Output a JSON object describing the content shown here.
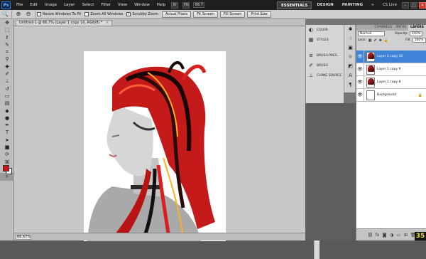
{
  "menubar": {
    "logo": "Ps",
    "items": [
      "File",
      "Edit",
      "Image",
      "Layer",
      "Select",
      "Filter",
      "View",
      "Window",
      "Help"
    ],
    "bridge_icon": "Br",
    "mini_bridge_icon": "Mb",
    "zoom_value": "66.7",
    "workspaces": [
      "ESSENTIALS",
      "DESIGN",
      "PAINTING",
      "»"
    ],
    "cs_live": "CS Live",
    "window_controls": [
      "–",
      "□",
      "×"
    ]
  },
  "options": {
    "checks": [
      {
        "label": "Resize Windows To Fit",
        "checked": false
      },
      {
        "label": "Zoom All Windows",
        "checked": false
      },
      {
        "label": "Scrubby Zoom",
        "checked": true
      }
    ],
    "buttons": [
      "Actual Pixels",
      "Fit Screen",
      "Fill Screen",
      "Print Size"
    ]
  },
  "document": {
    "tab_title": "Untitled-1 @ 66.7% (Layer 1 copy 10, RGB/8) *",
    "close": "×",
    "status_zoom": "66.67%"
  },
  "tools": [
    "move-icon",
    "marquee-icon",
    "lasso-icon",
    "quick-select-icon",
    "crop-icon",
    "eyedropper-icon",
    "healing-icon",
    "brush-icon",
    "clone-stamp-icon",
    "history-brush-icon",
    "eraser-icon",
    "gradient-icon",
    "blur-icon",
    "dodge-icon",
    "pen-icon",
    "type-icon",
    "path-select-icon",
    "shape-icon",
    "3d-rotate-icon",
    "3d-camera-icon",
    "hand-icon",
    "zoom-icon"
  ],
  "swatches": {
    "foreground": "#c8161a",
    "background": "#ffffff"
  },
  "collapsed_panels": {
    "group1": [
      {
        "icon": "color-icon",
        "label": "COLOR"
      },
      {
        "icon": "styles-icon",
        "label": "STYLES"
      }
    ],
    "group2": [
      {
        "icon": "brush-presets-icon",
        "label": "BRUSH PRES..."
      },
      {
        "icon": "brush-icon",
        "label": "BRUSH"
      },
      {
        "icon": "clone-source-icon",
        "label": "CLONE SOURCE"
      }
    ]
  },
  "layers_panel": {
    "tabs": [
      "CHANNELS",
      "PATHS",
      "LAYERS"
    ],
    "blend_mode": "Normal",
    "opacity_label": "Opacity:",
    "opacity": "100%",
    "lock_label": "Lock:",
    "fill_label": "Fill:",
    "fill": "100%",
    "layers": [
      {
        "name": "Layer 1 copy 10",
        "selected": true
      },
      {
        "name": "Layer 1 copy 9",
        "selected": false
      },
      {
        "name": "Layer 1 copy 8",
        "selected": false
      },
      {
        "name": "Background",
        "selected": false,
        "locked": true
      }
    ],
    "footer_icons": [
      "link-icon",
      "fx-icon",
      "mask-icon",
      "adjustment-icon",
      "group-icon",
      "new-layer-icon",
      "trash-icon"
    ]
  },
  "badge": "35",
  "colors": {
    "selection": "#3e83d8",
    "menubar": "#1f1f1f",
    "hair_red": "#d82020"
  }
}
